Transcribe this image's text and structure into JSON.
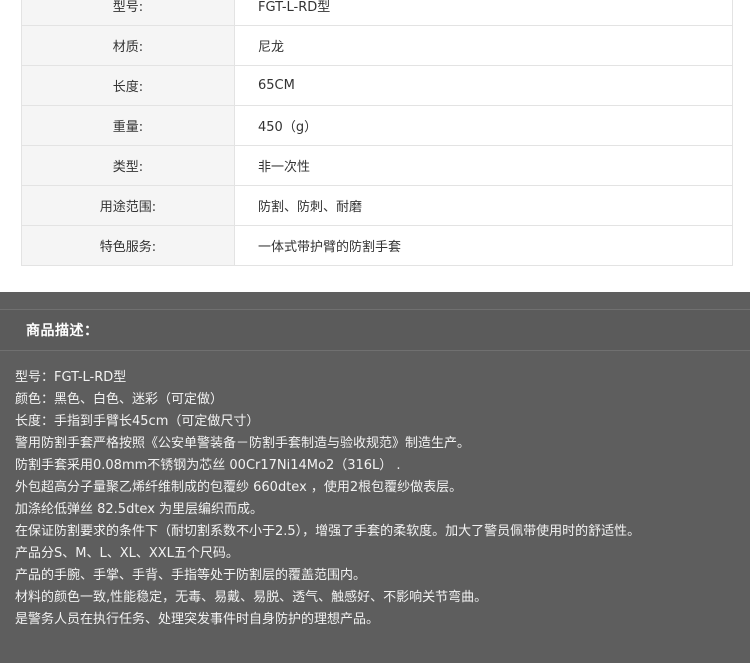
{
  "specs": [
    {
      "key": "型号:",
      "value": "FGT-L-RD型"
    },
    {
      "key": "材质:",
      "value": "尼龙"
    },
    {
      "key": "长度:",
      "value": "65CM"
    },
    {
      "key": "重量:",
      "value": "450（g）"
    },
    {
      "key": "类型:",
      "value": "非一次性"
    },
    {
      "key": "用途范围:",
      "value": "防割、防刺、耐磨"
    },
    {
      "key": "特色服务:",
      "value": "一体式带护臂的防割手套"
    }
  ],
  "description": {
    "title": "商品描述：",
    "lines": [
      "型号：FGT-L-RD型",
      "颜色：黑色、白色、迷彩（可定做）",
      "长度：手指到手臂长45cm（可定做尺寸）",
      "警用防割手套严格按照《公安单警装备－防割手套制造与验收规范》制造生产。",
      "防割手套采用0.08mm不锈钢为芯丝 00Cr17Ni14Mo2（316L） .",
      "外包超高分子量聚乙烯纤维制成的包覆纱 660dtex ，使用2根包覆纱做表层。",
      "加涤纶低弹丝 82.5dtex 为里层编织而成。",
      "在保证防割要求的条件下（耐切割系数不小于2.5），增强了手套的柔软度。加大了警员佩带使用时的舒适性。",
      "产品分S、M、L、XL、XXL五个尺码。",
      "产品的手腕、手掌、手背、手指等处于防割层的覆盖范围内。",
      "材料的颜色一致,性能稳定，无毒、易戴、易脱、透气、触感好、不影响关节弯曲。",
      "是警务人员在执行任务、处理突发事件时自身防护的理想产品。"
    ]
  }
}
